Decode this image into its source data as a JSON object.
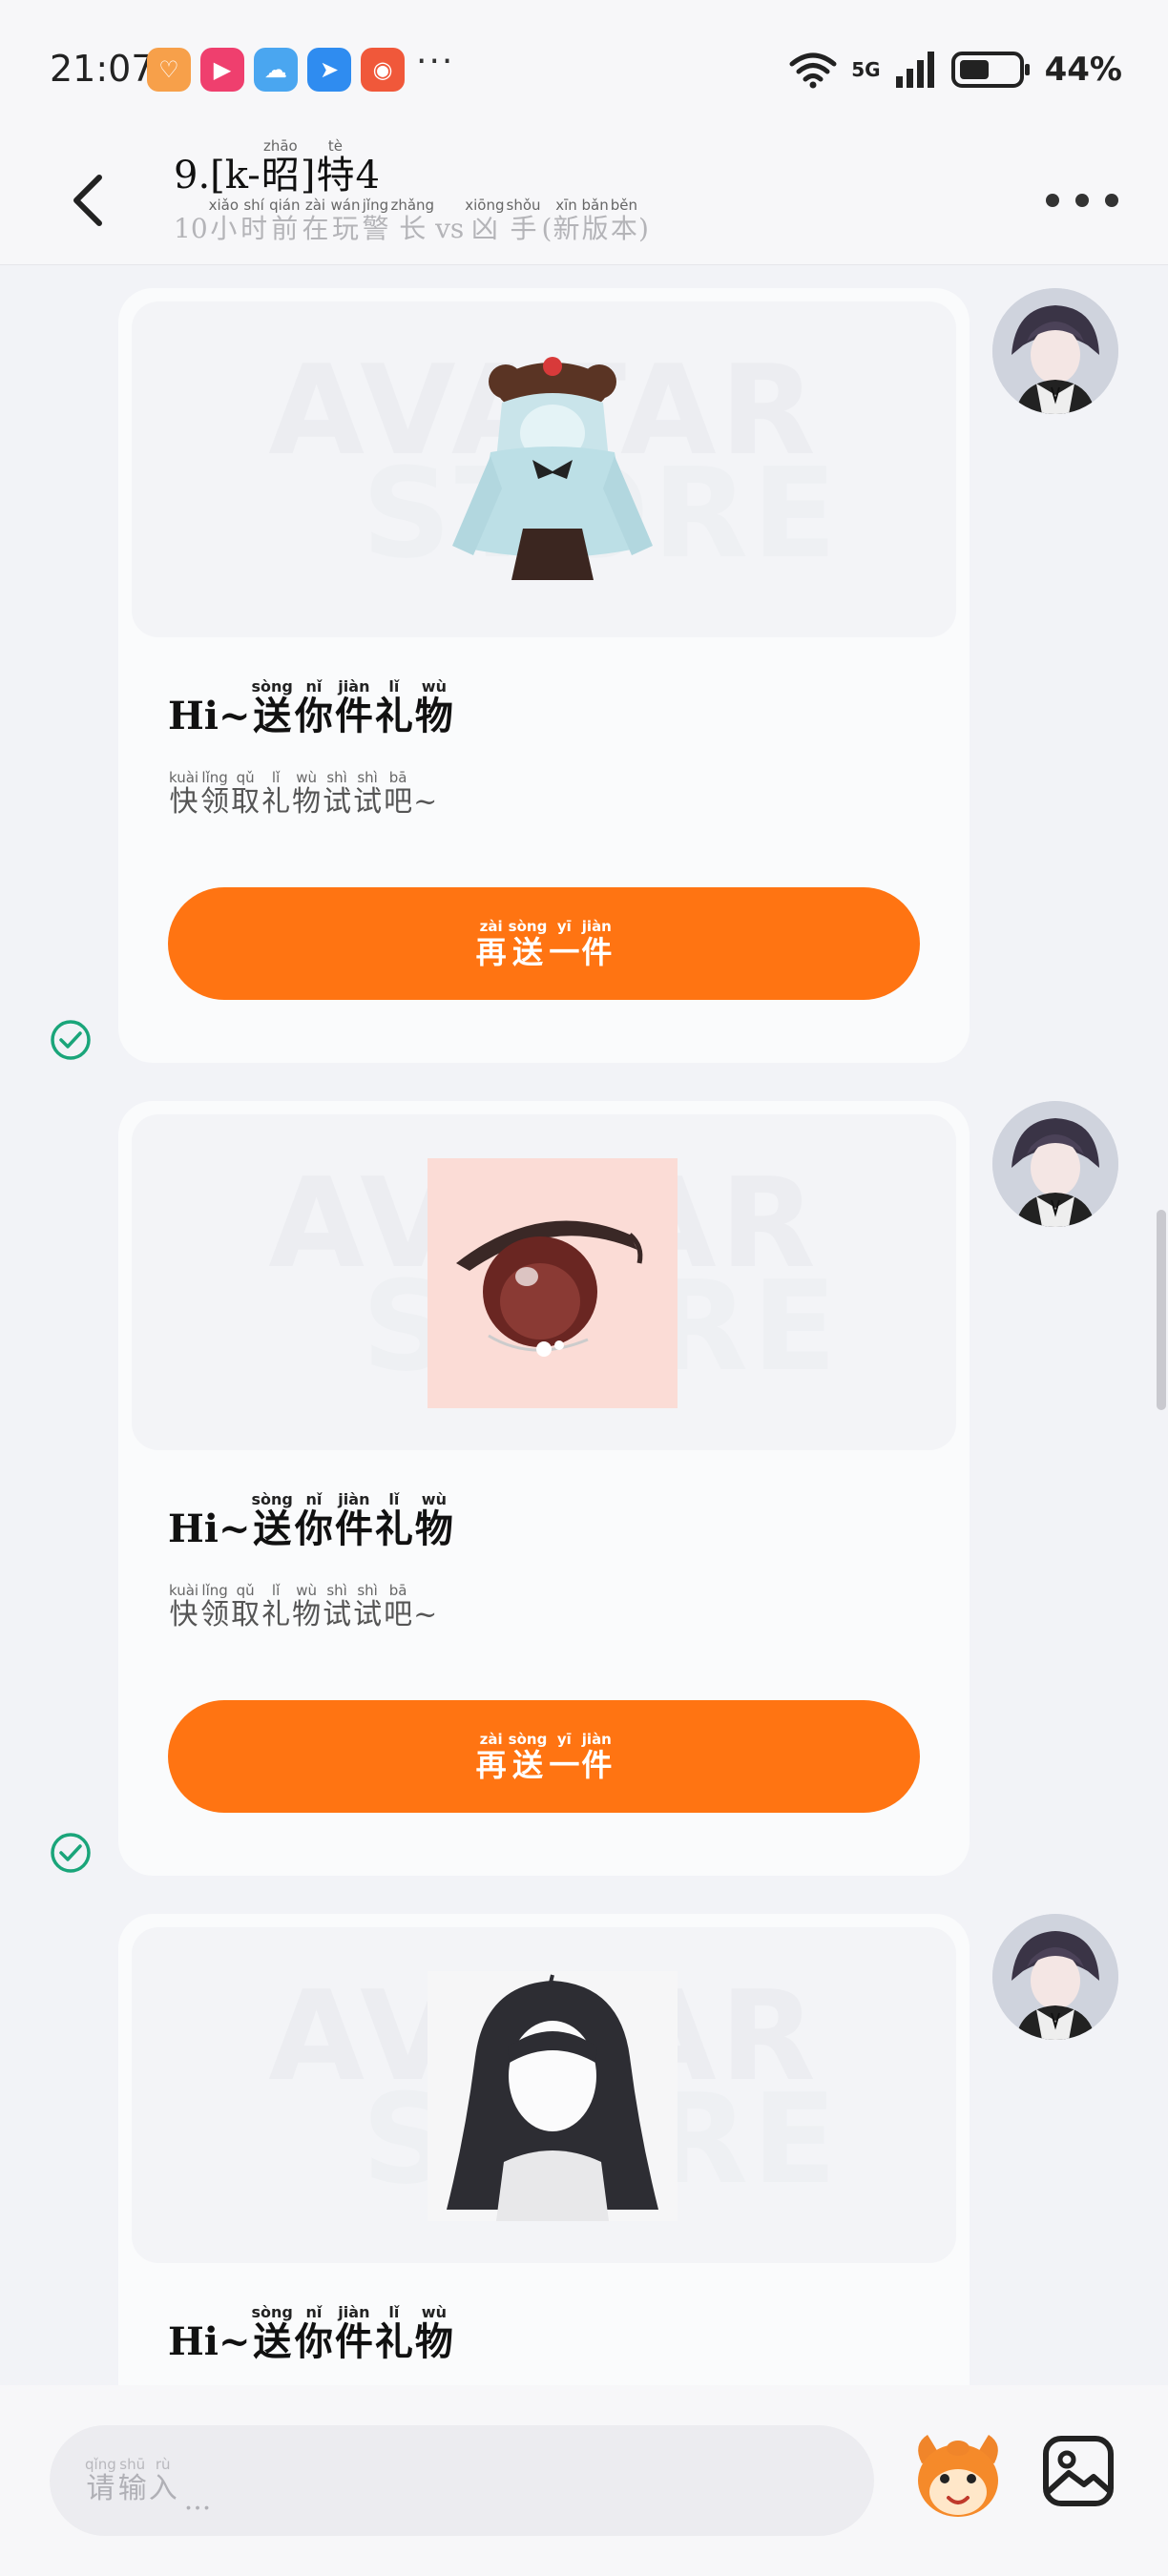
{
  "status_bar": {
    "time": "21:07",
    "network": "5G",
    "battery": "44%",
    "app_icons": [
      "store-app-icon",
      "video-app-icon",
      "weather-app-icon",
      "bird-app-icon",
      "kuaishou-app-icon"
    ],
    "more": "···"
  },
  "header": {
    "title": [
      {
        "t": "9.[k-"
      },
      {
        "c": "昭",
        "p": "zhāo"
      },
      {
        "t": "]"
      },
      {
        "c": "特",
        "p": "tè"
      },
      {
        "t": "4"
      }
    ],
    "subtitle": [
      {
        "t": "10"
      },
      {
        "c": "小",
        "p": "xiǎo"
      },
      {
        "c": "时",
        "p": "shí"
      },
      {
        "c": "前",
        "p": "qián"
      },
      {
        "c": "在",
        "p": "zài"
      },
      {
        "c": "玩",
        "p": "wán"
      },
      {
        "c": "警",
        "p": "jǐng"
      },
      {
        "c": "长",
        "p": "zhǎng"
      },
      {
        "t": "vs"
      },
      {
        "c": "凶",
        "p": "xiōng"
      },
      {
        "c": "手",
        "p": "shǒu"
      },
      {
        "t": "("
      },
      {
        "c": "新",
        "p": "xīn"
      },
      {
        "c": "版",
        "p": "bǎn"
      },
      {
        "c": "本",
        "p": "běn"
      },
      {
        "t": ")"
      }
    ]
  },
  "watermark": {
    "line1": "AVATAR",
    "line2": "STORE"
  },
  "messages": [
    {
      "item": "hoodie-outfit",
      "title": [
        {
          "t": "Hi~"
        },
        {
          "c": "送",
          "p": "sòng"
        },
        {
          "c": "你",
          "p": "nǐ"
        },
        {
          "c": "件",
          "p": "jiàn"
        },
        {
          "c": "礼",
          "p": "lǐ"
        },
        {
          "c": "物",
          "p": "wù"
        }
      ],
      "desc": [
        {
          "c": "快",
          "p": "kuài"
        },
        {
          "c": "领",
          "p": "lǐng"
        },
        {
          "c": "取",
          "p": "qǔ"
        },
        {
          "c": "礼",
          "p": "lǐ"
        },
        {
          "c": "物",
          "p": "wù"
        },
        {
          "c": "试",
          "p": "shì"
        },
        {
          "c": "试",
          "p": "shì"
        },
        {
          "c": "吧",
          "p": "bā"
        },
        {
          "t": "~"
        }
      ],
      "button": [
        {
          "c": "再",
          "p": "zài"
        },
        {
          "c": "送",
          "p": "sòng"
        },
        {
          "c": "一",
          "p": "yī"
        },
        {
          "c": "件",
          "p": "jiàn"
        }
      ],
      "read": true
    },
    {
      "item": "anime-eye",
      "title": [
        {
          "t": "Hi~"
        },
        {
          "c": "送",
          "p": "sòng"
        },
        {
          "c": "你",
          "p": "nǐ"
        },
        {
          "c": "件",
          "p": "jiàn"
        },
        {
          "c": "礼",
          "p": "lǐ"
        },
        {
          "c": "物",
          "p": "wù"
        }
      ],
      "desc": [
        {
          "c": "快",
          "p": "kuài"
        },
        {
          "c": "领",
          "p": "lǐng"
        },
        {
          "c": "取",
          "p": "qǔ"
        },
        {
          "c": "礼",
          "p": "lǐ"
        },
        {
          "c": "物",
          "p": "wù"
        },
        {
          "c": "试",
          "p": "shì"
        },
        {
          "c": "试",
          "p": "shì"
        },
        {
          "c": "吧",
          "p": "bā"
        },
        {
          "t": "~"
        }
      ],
      "button": [
        {
          "c": "再",
          "p": "zài"
        },
        {
          "c": "送",
          "p": "sòng"
        },
        {
          "c": "一",
          "p": "yī"
        },
        {
          "c": "件",
          "p": "jiàn"
        }
      ],
      "read": true
    },
    {
      "item": "long-black-hair",
      "title": [
        {
          "t": "Hi~"
        },
        {
          "c": "送",
          "p": "sòng"
        },
        {
          "c": "你",
          "p": "nǐ"
        },
        {
          "c": "件",
          "p": "jiàn"
        },
        {
          "c": "礼",
          "p": "lǐ"
        },
        {
          "c": "物",
          "p": "wù"
        }
      ],
      "desc": [],
      "button": [],
      "read": false
    }
  ],
  "input": {
    "placeholder": [
      {
        "c": "请",
        "p": "qǐng"
      },
      {
        "c": "输",
        "p": "shū"
      },
      {
        "c": "入",
        "p": "rù"
      }
    ],
    "ellipsis": "..."
  },
  "colors": {
    "accent": "#ff7412",
    "check": "#1aa57a",
    "background": "#f2f3f7"
  }
}
